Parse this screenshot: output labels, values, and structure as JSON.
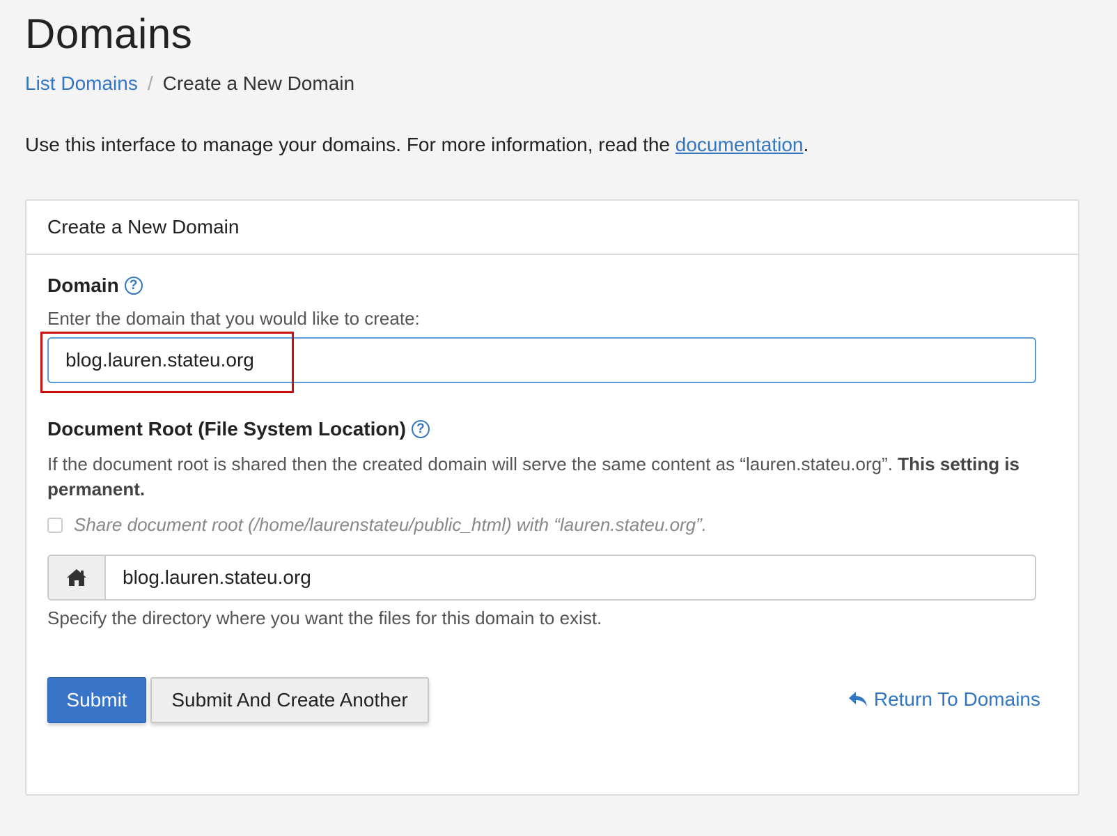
{
  "page": {
    "title": "Domains"
  },
  "breadcrumb": {
    "parent_label": "List Domains",
    "separator": "/",
    "current_label": "Create a New Domain"
  },
  "intro": {
    "text": "Use this interface to manage your domains. For more information, read the ",
    "link_label": "documentation",
    "suffix": "."
  },
  "panel": {
    "heading": "Create a New Domain",
    "domain": {
      "label": "Domain",
      "help_text": "Enter the domain that you would like to create:",
      "value": "blog.lauren.stateu.org"
    },
    "document_root": {
      "label": "Document Root (File System Location)",
      "description": "If the document root is shared then the created domain will serve the same content as “lauren.stateu.org”. ",
      "description_bold": "This setting is permanent.",
      "share_label": "Share document root (/home/laurenstateu/public_html) with “lauren.stateu.org”.",
      "share_checked": false,
      "value": "blog.lauren.stateu.org",
      "hint": "Specify the directory where you want the files for this domain to exist."
    },
    "actions": {
      "submit_label": "Submit",
      "submit_another_label": "Submit And Create Another",
      "return_label": "Return To Domains"
    }
  },
  "colors": {
    "link": "#3276c4",
    "primary_button": "#3874c8",
    "highlight": "#cc1111"
  },
  "icons": {
    "help": "question-circle-icon",
    "home": "home-icon",
    "return": "reply-arrow-icon"
  }
}
